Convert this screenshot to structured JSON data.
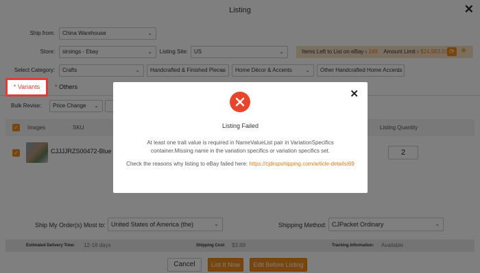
{
  "window": {
    "title": "Listing"
  },
  "form": {
    "ship_from": {
      "label": "Ship from:",
      "value": "China Warehouse"
    },
    "store": {
      "label": "Store:",
      "value": "sirsings - Ebay"
    },
    "listing_site": {
      "label": "Listing Site:",
      "value": "US"
    },
    "items_left": {
      "label": "Items Left to List on eBay ›",
      "count": "249",
      "amount_label": "Amount Limit ›",
      "amount": "$24,983.01"
    },
    "category": {
      "label": "Select Category:",
      "levels": [
        "Crafts",
        "Handcrafted & Finished Pieces",
        "Home Décor & Accents",
        "Other Handcrafted Home Accents"
      ]
    }
  },
  "tabs": [
    {
      "label": "Variants",
      "required": "*"
    },
    {
      "label": "Others",
      "required": "*"
    }
  ],
  "bulk": {
    "label": "Bulk Revise:",
    "value": "Price Change"
  },
  "table": {
    "headers": [
      "Images",
      "SKU",
      "Listing Quantity"
    ],
    "rows": [
      {
        "sku": "CJJJJRZS00472-Blue",
        "quantity": "2"
      }
    ]
  },
  "shipping": {
    "ship_to_label": "Ship My Order(s) Most to:",
    "ship_to_value": "United States of America (the)",
    "method_label": "Shipping Method:",
    "method_value": "CJPacket Ordinary",
    "delivery_label": "Estimated Delivery Time:",
    "delivery_value": "12-18 days",
    "cost_label": "Shipping Cost:",
    "cost_value": "$3.69",
    "tracking_label": "Tracking Information:",
    "tracking_value": "Available"
  },
  "buttons": {
    "cancel": "Cancel",
    "list": "List It Now",
    "edit": "Edit Before Listing"
  },
  "modal": {
    "title": "Listing Failed",
    "message_line1": "At least one trait value is required in NameValueList pair in VariationSpecifics",
    "message_line2": "container.Missing name in the variation specifics or variation specifics set.",
    "reason_prefix": "Check the reasons why listing to eBay failed here: ",
    "reason_link": "https://cjdropshipping.com/article-details/69"
  },
  "colors": {
    "accent": "#f08a1c",
    "error": "#e8452a",
    "highlight": "#e53935"
  }
}
